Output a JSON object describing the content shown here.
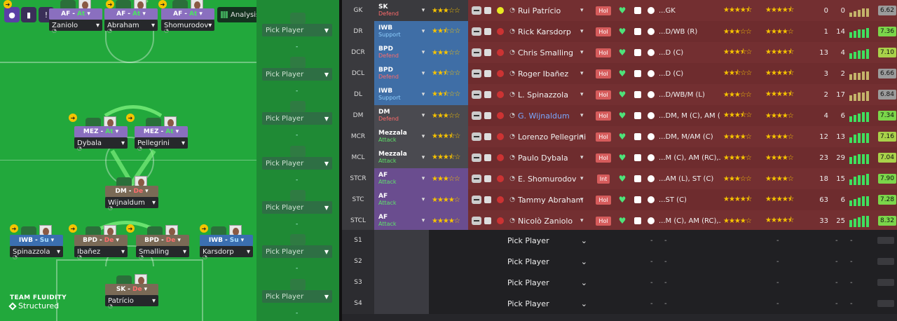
{
  "toolbar": {
    "analysis_label": "Analysis"
  },
  "pitch": {
    "fluidity_title": "TEAM FLUIDITY",
    "fluidity_value": "Structured",
    "players": [
      {
        "role": "AF",
        "duty": "At",
        "duty_type": "at",
        "name": "Zaniolo"
      },
      {
        "role": "AF",
        "duty": "At",
        "duty_type": "at",
        "name": "Abraham"
      },
      {
        "role": "AF",
        "duty": "At",
        "duty_type": "at",
        "name": "Shomurodov"
      },
      {
        "role": "MEZ",
        "duty": "At",
        "duty_type": "at",
        "name": "Dybala"
      },
      {
        "role": "MEZ",
        "duty": "At",
        "duty_type": "at",
        "name": "Pellegrini"
      },
      {
        "role": "DM",
        "duty": "De",
        "duty_type": "de",
        "name": "Wijnaldum"
      },
      {
        "role": "IWB",
        "duty": "Su",
        "duty_type": "su",
        "name": "Spinazzola"
      },
      {
        "role": "BPD",
        "duty": "De",
        "duty_type": "de",
        "name": "Ibañez"
      },
      {
        "role": "BPD",
        "duty": "De",
        "duty_type": "de",
        "name": "Smalling"
      },
      {
        "role": "IWB",
        "duty": "Su",
        "duty_type": "su",
        "name": "Karsdorp"
      },
      {
        "role": "SK",
        "duty": "De",
        "duty_type": "de",
        "name": "Patrício"
      }
    ]
  },
  "subs_panel": {
    "pick_label": "Pick Player",
    "dash": "-"
  },
  "table": {
    "rows": [
      {
        "pos": "GK",
        "role": "SK",
        "duty": "Defend",
        "name": "Rui Patrício",
        "tag": "Hol",
        "positions": "...GK",
        "n1": "0",
        "n2": "0",
        "rating": "6.62",
        "duty_color": "#ff6b6b",
        "band": "#3a3a3e"
      },
      {
        "pos": "DR",
        "role": "IWB",
        "duty": "Support",
        "name": "Rick Karsdorp",
        "tag": "Hol",
        "positions": "...D/WB (R)",
        "n1": "1",
        "n2": "14",
        "rating": "7.36",
        "duty_color": "#8fd0ff",
        "band": "#3f6ea6"
      },
      {
        "pos": "DCR",
        "role": "BPD",
        "duty": "Defend",
        "name": "Chris Smalling",
        "tag": "Hol",
        "positions": "...D (C)",
        "n1": "13",
        "n2": "4",
        "rating": "7.10",
        "duty_color": "#ff6b6b",
        "band": "#3f6ea6"
      },
      {
        "pos": "DCL",
        "role": "BPD",
        "duty": "Defend",
        "name": "Roger Ibañez",
        "tag": "Hol",
        "positions": "...D (C)",
        "n1": "3",
        "n2": "2",
        "rating": "6.66",
        "duty_color": "#ff6b6b",
        "band": "#3f6ea6"
      },
      {
        "pos": "DL",
        "role": "IWB",
        "duty": "Support",
        "name": "L. Spinazzola",
        "tag": "Hol",
        "positions": "...D/WB/M (L)",
        "n1": "2",
        "n2": "17",
        "rating": "6.84",
        "duty_color": "#8fd0ff",
        "band": "#3f6ea6"
      },
      {
        "pos": "DM",
        "role": "DM",
        "duty": "Defend",
        "name": "G. Wijnaldum",
        "tag": "Hol",
        "positions": "...DM, M (C), AM (...",
        "n1": "4",
        "n2": "6",
        "rating": "7.34",
        "duty_color": "#ff6b6b",
        "band": "#4a4a50"
      },
      {
        "pos": "MCR",
        "role": "Mezzala",
        "duty": "Attack",
        "name": "Lorenzo Pellegrini",
        "tag": "Hol",
        "positions": "...DM, M/AM (C)",
        "n1": "12",
        "n2": "13",
        "rating": "7.16",
        "duty_color": "#5fe36a",
        "band": "#4a4a50"
      },
      {
        "pos": "MCL",
        "role": "Mezzala",
        "duty": "Attack",
        "name": "Paulo Dybala",
        "tag": "Hol",
        "positions": "...M (C), AM (RC),...",
        "n1": "23",
        "n2": "29",
        "rating": "7.04",
        "duty_color": "#5fe36a",
        "band": "#4a4a50"
      },
      {
        "pos": "STCR",
        "role": "AF",
        "duty": "Attack",
        "name": "E. Shomurodov",
        "tag": "Int",
        "positions": "...AM (L), ST (C)",
        "n1": "18",
        "n2": "15",
        "rating": "7.90",
        "duty_color": "#5fe36a",
        "band": "#6a4d8f"
      },
      {
        "pos": "STC",
        "role": "AF",
        "duty": "Attack",
        "name": "Tammy Abraham",
        "tag": "Hol",
        "positions": "...ST (C)",
        "n1": "63",
        "n2": "6",
        "rating": "7.28",
        "duty_color": "#5fe36a",
        "band": "#6a4d8f"
      },
      {
        "pos": "STCL",
        "role": "AF",
        "duty": "Attack",
        "name": "Nicolò Zaniolo",
        "tag": "Hol",
        "positions": "...M (C), AM (RC),...",
        "n1": "33",
        "n2": "25",
        "rating": "8.32",
        "duty_color": "#5fe36a",
        "band": "#6a4d8f"
      }
    ],
    "subs": [
      {
        "pos": "S1",
        "label": "Pick Player"
      },
      {
        "pos": "S2",
        "label": "Pick Player"
      },
      {
        "pos": "S3",
        "label": "Pick Player"
      },
      {
        "pos": "S4",
        "label": "Pick Player"
      }
    ],
    "dash": "-"
  }
}
